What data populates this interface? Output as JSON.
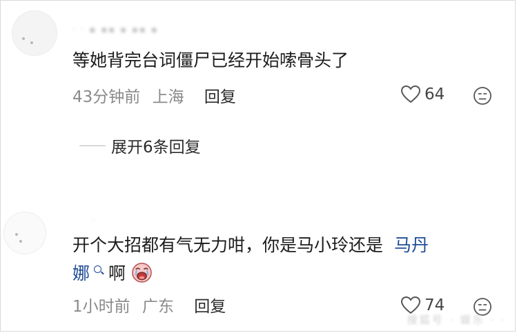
{
  "comments": [
    {
      "username": "· · ▪ ▪▪ ▪ ▪▪ ▪",
      "text": "等她背完台词僵尸已经开始嗦骨头了",
      "time": "43分钟前",
      "location": "上海",
      "reply_label": "回复",
      "likes": "64",
      "expand_label": "展开6条回复"
    },
    {
      "username": "·",
      "text_line1": "开个大招都有气无力咁，你是马小玲还是",
      "mention_part1": "马丹",
      "mention_part2": "娜",
      "text_end": "啊",
      "emoji_name": "crying-face-emoji",
      "time": "1小时前",
      "location": "广东",
      "reply_label": "回复",
      "likes": "74"
    }
  ],
  "icons": {
    "like": "heart-outline-icon",
    "dislike": "sad-face-icon",
    "mention": "search-icon"
  },
  "colors": {
    "mention": "#1f4c96",
    "meta": "#8a8a8a",
    "text": "#1b1b1b"
  },
  "watermark": "搜狐号 · 娱乐 · ·"
}
